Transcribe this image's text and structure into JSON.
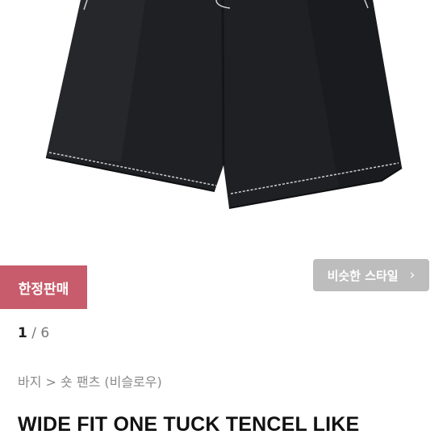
{
  "badge": {
    "label": "한정판매"
  },
  "similar_style": {
    "label": "비슷한 스타일",
    "icon": "chevron-right-icon"
  },
  "image_counter": {
    "current": "1",
    "separator": "/",
    "total": "6"
  },
  "breadcrumb": {
    "category": "바지",
    "separator": ">",
    "subcategory": "숏 팬츠 (비슬로우)"
  },
  "product": {
    "title": "WIDE FIT ONE TUCK TENCEL LIKE"
  },
  "colors": {
    "badge": "#c85c6c",
    "button": "#bdbdbd",
    "garment": "#1f2024",
    "stitch": "#cfcfcf"
  }
}
